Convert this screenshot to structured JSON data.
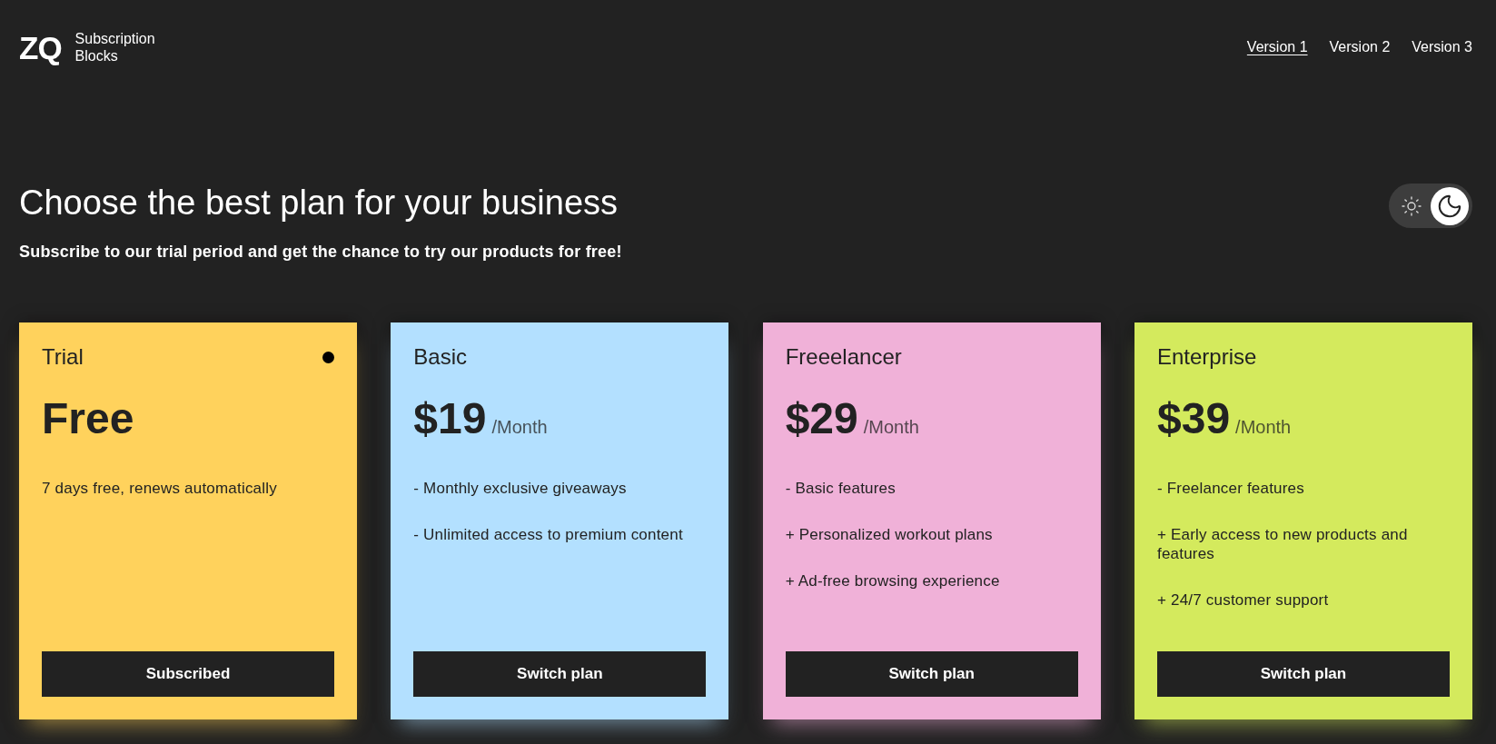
{
  "header": {
    "logo": {
      "mark": "ZQ",
      "name": "Subscription Blocks"
    },
    "nav": [
      {
        "label": "Version 1",
        "selected": true
      },
      {
        "label": "Version 2",
        "selected": false
      },
      {
        "label": "Version 3",
        "selected": false
      }
    ]
  },
  "hero": {
    "title": "Choose the best plan for your business",
    "subtitle": "Subscribe to our trial period and get the chance to try our products for free!",
    "theme_switch": {
      "on": true
    }
  },
  "plans": [
    {
      "name": "Trial",
      "color": "#ffd25c",
      "selected": true,
      "price": "Free",
      "features": [
        "7 days free, renews automatically"
      ],
      "button": "Subscribed"
    },
    {
      "name": "Basic",
      "color": "#b3e0ff",
      "selected": false,
      "price": "$19",
      "period": "/Month",
      "features": [
        "- Monthly exclusive giveaways",
        "- Unlimited access to premium content"
      ],
      "button": "Switch plan"
    },
    {
      "name": "Freeelancer",
      "color": "#f0b1d8",
      "selected": false,
      "price": "$29",
      "period": "/Month",
      "features": [
        "- Basic features",
        "+ Personalized workout plans",
        "+ Ad-free browsing experience"
      ],
      "button": "Switch plan"
    },
    {
      "name": "Enterprise",
      "color": "#d4ea5d",
      "selected": false,
      "price": "$39",
      "period": "/Month",
      "features": [
        "- Freelancer features",
        "+ Early access to new products and features",
        "+ 24/7 customer support"
      ],
      "button": "Switch plan"
    }
  ]
}
